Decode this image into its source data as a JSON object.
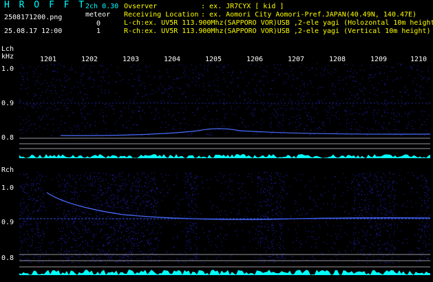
{
  "header": {
    "logo": "H R O F F T",
    "version": "2ch 0.30",
    "filename": "2508171200.png",
    "datetime": "25.08.17 12:00",
    "meteor_label": "meteor",
    "meteor_lch": "0",
    "meteor_rch": "1",
    "observer_label": "Ovserver",
    "observer_value": ": ex. JR7CYX [ kid ]",
    "location_label": "Receiving Location",
    "location_value": ": ex. Aomori City Aomori-Pref.JAPAN(40.49N, 140.47E)",
    "lch_info": "L-ch:ex. UV5R 113.900Mhz(SAPPORO VOR)USB ,2-ele yagi (Holozontal 10m height)",
    "rch_info": "R-ch:ex. UV5R 113.900Mhz(SAPPORO VOR)USB ,2-ele yagi (Vertical 10m height)"
  },
  "x_ticks": [
    "1201",
    "1202",
    "1203",
    "1204",
    "1205",
    "1206",
    "1207",
    "1208",
    "1209",
    "1210"
  ],
  "left_panel": {
    "label": "Lch",
    "unit": "kHz",
    "ticks": [
      "1.0",
      "0.9",
      "0.8"
    ]
  },
  "right_panel": {
    "label": "Rch",
    "ticks": [
      "1.0",
      "0.9",
      "0.8"
    ]
  },
  "colors": {
    "cyan": "#00ffff",
    "bg": "#000000",
    "noise": "#1a1a90",
    "trace": "#4a6cff"
  }
}
